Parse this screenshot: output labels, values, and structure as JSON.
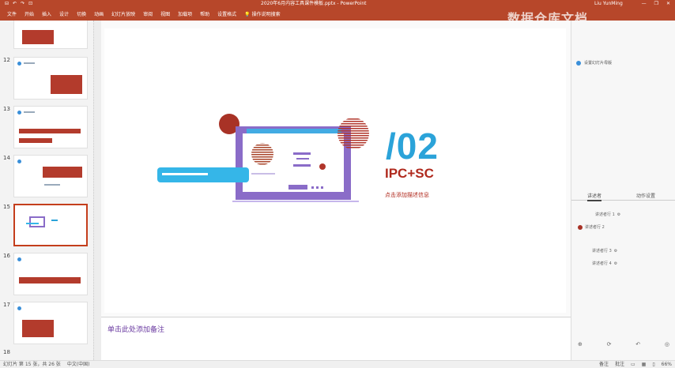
{
  "titlebar": {
    "quick_access": [
      "⊟",
      "↶",
      "↷",
      "⊡"
    ],
    "document_title": "2020年6月内容工具课件模板.pptx  -  PowerPoint",
    "user": "Liu YunMing",
    "window_controls": [
      "—",
      "❐",
      "✕"
    ]
  },
  "ribbon": {
    "tabs": [
      "文件",
      "开始",
      "插入",
      "设计",
      "切换",
      "动画",
      "幻灯片放映",
      "审阅",
      "视图",
      "加载项",
      "帮助",
      "设置格式",
      "操作说明搜索"
    ],
    "watermark": "数据仓库文档"
  },
  "thumbnails": {
    "numbers": [
      "12",
      "13",
      "14",
      "15",
      "16",
      "17",
      "18"
    ]
  },
  "slide": {
    "number": "/02",
    "title": "IPC+SC",
    "subtitle": "点击添加描述信息"
  },
  "notes": {
    "placeholder": "单击此处添加备注"
  },
  "right_pane": {
    "top_item": "设置幻灯片母版",
    "tabs": [
      "讲述者",
      "动作设置"
    ],
    "rows": [
      "讲述者行 1",
      "讲述者行 2",
      "讲述者行 3",
      "讲述者行 4"
    ]
  },
  "statusbar": {
    "slide_info": "幻灯片 第 15 张，共 26 张",
    "language": "中文(中国)",
    "notes_label": "备注",
    "comments_label": "批注",
    "zoom": "66%"
  },
  "colors": {
    "accent": "#b7472a",
    "slide_purple": "#8a6cc8",
    "slide_cyan": "#35b6e8",
    "slide_red": "#a83226",
    "title_blue": "#2ba3d9",
    "title_red": "#b02a1e"
  }
}
